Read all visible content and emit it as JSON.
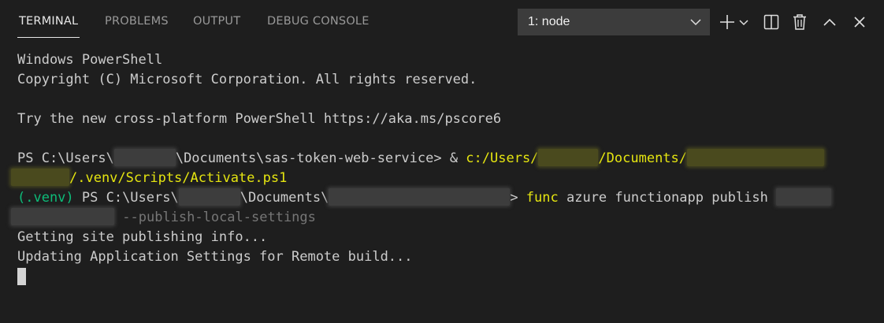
{
  "tabs": [
    {
      "label": "TERMINAL",
      "active": true
    },
    {
      "label": "PROBLEMS",
      "active": false
    },
    {
      "label": "OUTPUT",
      "active": false
    },
    {
      "label": "DEBUG CONSOLE",
      "active": false
    }
  ],
  "terminal_select": {
    "value": "1: node"
  },
  "actions": [
    "plus-icon",
    "chevron-down-icon",
    "split-icon",
    "trash-icon",
    "chevron-up-icon",
    "close-icon"
  ],
  "colors": {
    "background": "#1e1e1e",
    "text": "#cccccc",
    "yellow": "#e5e510",
    "green": "#0dbc79",
    "dim": "#767676"
  },
  "terminal": {
    "line1": "Windows PowerShell",
    "line2": "Copyright (C) Microsoft Corporation. All rights reserved.",
    "line3": "Try the new cross-platform PowerShell https://aka.ms/pscore6",
    "line4_a": "PS C:\\Users\\",
    "line4_b": "\\Documents\\sas-token-web-service> & ",
    "line4_c": "c:/Users/",
    "line4_d": "/Documents/",
    "line5_a": "/.venv/Scripts/Activate.ps1",
    "line6_venv": "(.venv)",
    "line6_a": " PS C:\\Users\\",
    "line6_b": "\\Documents\\",
    "line6_c": "> ",
    "line6_func": "func",
    "line6_d": " azure functionapp publish ",
    "line7_flag": "--publish-local-settings",
    "line8": "Getting site publishing info...",
    "line9": "Updating Application Settings for Remote build..."
  }
}
